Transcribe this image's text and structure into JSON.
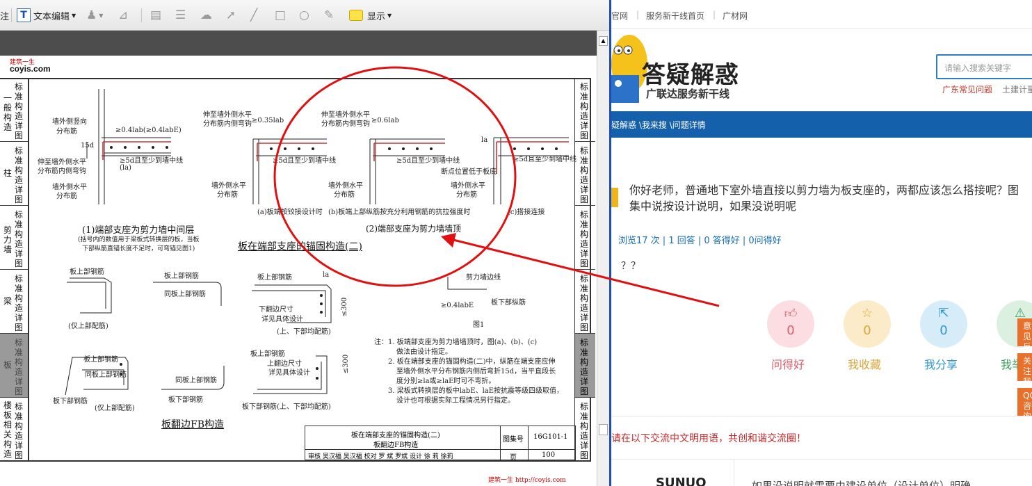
{
  "pdf_viewer": {
    "toolbar": {
      "cut_label": "注",
      "text_edit_label": "文本编辑",
      "show_label": "显示"
    },
    "page": {
      "logo_small": "建筑一生",
      "logo_main": "coyis.com",
      "left_tabs": [
        {
          "big": "一般构造",
          "small": "标准构造详图"
        },
        {
          "big": "柱",
          "small": "标准构造详图"
        },
        {
          "big": "剪力墙",
          "small": "标准构造详图"
        },
        {
          "big": "梁",
          "small": "标准构造详图"
        },
        {
          "big": "板",
          "small": "标准构造详图"
        },
        {
          "big": "楼板相关构造",
          "small": "标准构造详图"
        }
      ],
      "right_tab_text": "标准构造详图",
      "labels": {
        "l1": "墙外侧竖向",
        "l1b": "分布筋",
        "l2": "≥0.4lab(≥0.4labE)",
        "l3": "伸至墙外侧水平",
        "l3b": "分布筋内侧弯钩",
        "l4": "≥5d且至少到墙中线",
        "l4b": "(la)",
        "l5": "墙外侧水平",
        "l5b": "分布筋",
        "l6": "15d",
        "m1": "伸至墙外侧水平",
        "m1b": "分布筋内侧弯钩",
        "m2": "≥0.35lab",
        "m3": "≥5d且至少到墙中线",
        "m4": "墙外侧水平",
        "m4b": "分布筋",
        "m5": "(a)板端按铰接设计时",
        "n1": "伸至墙外侧水平",
        "n1b": "分布筋内侧弯钩",
        "n2": "≥0.6lab",
        "n3": "≥5d且至少到墙中线",
        "n4": "墙外侧水平",
        "n4b": "分布筋",
        "n5": "(b)板端上部纵筋按充分利用钢筋的抗拉强度时",
        "n6": "断点位置低于板底",
        "o1": "la",
        "o2": "≥5d且至少到墙中线",
        "o3": "墙外侧水平",
        "o3b": "分布筋",
        "o4": "(c)搭接连接",
        "p1": "板上部钢筋",
        "p2": "(仅上部配筋)",
        "p3": "板上部钢筋",
        "p4": "同板上部钢筋",
        "p5": "板上部钢筋",
        "p6": "下翻边尺寸",
        "p6b": "详见具体设计",
        "p7": "(上、下部均配筋)",
        "p8": "≤300",
        "p9": "lа",
        "q1": "剪力墙边线",
        "q2": "≥0.4labE",
        "q3": "板下部纵筋",
        "q4": "图1",
        "r1": "板上部钢筋",
        "r2": "同板上部钢筋",
        "r3": "(仅上部配筋)",
        "r4": "同板上部钢筋",
        "r5": "板下部钢筋",
        "r6": "板上部钢筋",
        "r7": "上翻边尺寸",
        "r7b": "详见具体设计",
        "r8": "板下部钢筋(上、下部均配筋)",
        "r9": "≤300"
      },
      "captions": {
        "c1": "(1)端部支座为剪力墙中间层",
        "c1a": "(括号内的数值用于梁板式转换层的板，当板",
        "c1b": "下部纵筋直锚长度不足时，可弯锚见图1)",
        "c2": "(2)端部支座为剪力墙墙顶",
        "main": "板在端部支座的锚固构造(二)",
        "fb": "板翻边FB构造"
      },
      "notes": [
        "注：1. 板端部支座为剪力墙墙顶时，图(a)、(b)、(c)",
        "做法由设计指定。",
        "2. 板在端部支座的锚固构造(二)中，纵筋在端支座应伸",
        "至墙外侧水平分布钢筋内侧后弯折15d，当平直段长",
        "度分别≥la或≥laE时可不弯折。",
        "3. 梁板式转换层的板中labE、laE按抗震等级四级取值，",
        "设计也可根据实际工程情况另行指定。"
      ],
      "title_block": {
        "title_line1": "板在端部支座的锚固构造(二)",
        "title_line2": "板翻边FB构造",
        "atlas_label": "图集号",
        "atlas_no": "16G101-1",
        "page_label": "页",
        "page_no": "100",
        "sign_row": "审核 吴汉福 吴汉福 校对 罗 斌 罗斌 设计 徐 莉 徐莉"
      },
      "footer": "建筑一生 http://coyis.com"
    }
  },
  "web": {
    "top_links": [
      "官网",
      "服务新干线首页",
      "广材网"
    ],
    "brand_title": "答疑解惑",
    "brand_subtitle": "广联达服务新干线",
    "search_placeholder": "请输入搜索关键字",
    "hot_links": [
      "广东常见问题",
      "土建计量"
    ],
    "breadcrumb": "疑解惑 \\我来搜 \\问题详情",
    "question_title": "你好老师，普通地下室外墙直接以剪力墙为板支座的，两都应该怎么搭接呢？图集中说按设计说明，如果没说明呢",
    "question_stats": "浏览17 次 | 1 回答 | 0 答得好 | 0问得好",
    "question_body": "？？",
    "actions": [
      {
        "label": "问得好",
        "count": "0",
        "icon": "thumbs-up-icon",
        "color": "#e05a6a",
        "bg": "#fbdde2"
      },
      {
        "label": "我收藏",
        "count": "0",
        "icon": "star-icon",
        "color": "#d7a63a",
        "bg": "#fcebc8"
      },
      {
        "label": "我分享",
        "count": "0",
        "icon": "share-icon",
        "color": "#2f97d4",
        "bg": "#d6ecf8"
      },
      {
        "label": "我举",
        "count": "",
        "icon": "warning-icon",
        "color": "#3aa25a",
        "bg": "#dcf0e1"
      }
    ],
    "float_buttons": [
      "意见反馈",
      "关注我们",
      "QQ咨询"
    ],
    "disclaimer": "请在以下交流中文明用语，共创和谐交流圈！",
    "answer_user": "SUNUO",
    "answer_preview": "如果没说明就需要由建设单位（设计单位）明确"
  }
}
